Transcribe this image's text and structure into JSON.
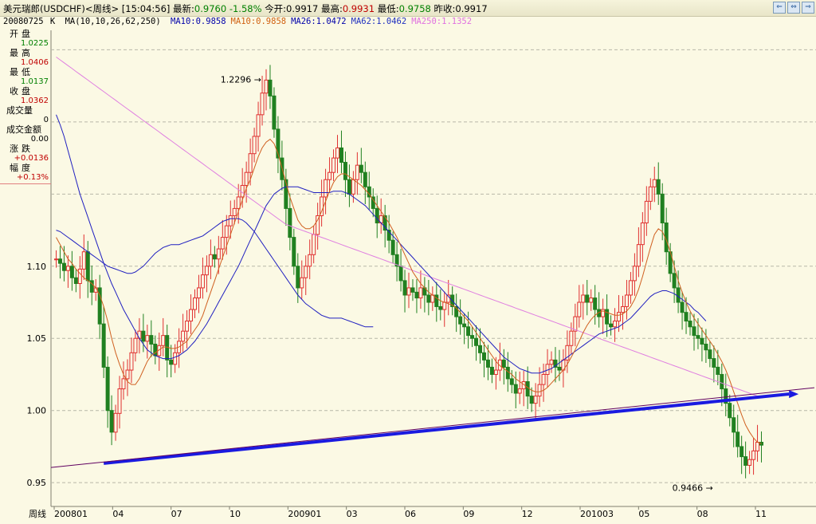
{
  "titlebar": {
    "instrument": "美元瑞郎(USDCHF)<周线>",
    "time": "[15:04:56]",
    "latest_label": "最新:",
    "latest_value": "0.9760",
    "change_pct": "-1.58%",
    "open_label": "今开:",
    "open_value": "0.9917",
    "high_label": "最高:",
    "high_value": "0.9931",
    "low_label": "最低:",
    "low_value": "0.9758",
    "prev_label": "昨收:",
    "prev_value": "0.9917"
  },
  "ma_legend": {
    "date": "20080725",
    "k": "K",
    "params": "MA(10,10,26,62,250)",
    "items": [
      {
        "label": "MA10:0.9858",
        "color": "#0000aa"
      },
      {
        "label": "MA10:0.9858",
        "color": "#d06010"
      },
      {
        "label": "MA26:1.0472",
        "color": "#0000aa"
      },
      {
        "label": "MA62:1.0462",
        "color": "#2030c0"
      },
      {
        "label": "MA250:1.1352",
        "color": "#e070e0"
      }
    ]
  },
  "side_panel": [
    {
      "label": "开盘",
      "value": "1.0225",
      "color": "#008000"
    },
    {
      "label": "最高",
      "value": "1.0406",
      "color": "#c00000"
    },
    {
      "label": "最低",
      "value": "1.0137",
      "color": "#008000"
    },
    {
      "label": "收盘",
      "value": "1.0362",
      "color": "#c00000"
    },
    {
      "label": "成交量",
      "value": "0",
      "color": "#000000"
    },
    {
      "label": "成交金额",
      "value": "0.00",
      "color": "#000000"
    },
    {
      "label": "涨跌",
      "value": "+0.0136",
      "color": "#c00000"
    },
    {
      "label": "幅度",
      "value": "+0.13%",
      "color": "#c00000"
    }
  ],
  "colors": {
    "up": "#e03030",
    "down": "#208020",
    "ma10": "#d06020",
    "ma26": "#2020c0",
    "ma250": "#e080e0",
    "trendline": "#1a1ae0",
    "grid": "#b8b8a8"
  },
  "chart_data": {
    "type": "candlestick",
    "period_label": "周线",
    "x_tick_labels": [
      "200801",
      "04",
      "07",
      "10",
      "200901",
      "03",
      "06",
      "09",
      "12",
      "201003",
      "05",
      "08",
      "11"
    ],
    "y_ticks": [
      0.95,
      1.0,
      1.05,
      1.1
    ],
    "y_tick_labels": [
      "0.95",
      "1.00",
      "1.05",
      "1.10"
    ],
    "ylim": [
      0.9335,
      1.2635
    ],
    "annotations": [
      {
        "text": "1.2296",
        "value": 1.2296,
        "week": 53
      },
      {
        "text": "0.9466",
        "value": 0.9466,
        "week": 167
      }
    ],
    "trendline": {
      "start": [
        12,
        0.9634
      ],
      "end": [
        191,
        1.0114
      ]
    },
    "close_series": [
      1.105,
      1.102,
      1.097,
      1.1,
      1.092,
      1.088,
      1.098,
      1.11,
      1.09,
      1.082,
      1.085,
      1.06,
      1.03,
      1.0,
      0.985,
      0.998,
      1.015,
      1.022,
      1.028,
      1.04,
      1.05,
      1.055,
      1.048,
      1.052,
      1.046,
      1.038,
      1.045,
      1.052,
      1.035,
      1.032,
      1.04,
      1.048,
      1.055,
      1.062,
      1.07,
      1.078,
      1.085,
      1.094,
      1.1,
      1.108,
      1.105,
      1.112,
      1.12,
      1.128,
      1.135,
      1.14,
      1.148,
      1.156,
      1.165,
      1.178,
      1.19,
      1.205,
      1.22,
      1.229,
      1.218,
      1.195,
      1.175,
      1.16,
      1.14,
      1.12,
      1.1,
      1.085,
      1.092,
      1.1,
      1.108,
      1.122,
      1.135,
      1.148,
      1.16,
      1.165,
      1.175,
      1.182,
      1.172,
      1.16,
      1.15,
      1.16,
      1.17,
      1.165,
      1.155,
      1.148,
      1.14,
      1.13,
      1.135,
      1.125,
      1.118,
      1.108,
      1.1,
      1.09,
      1.08,
      1.085,
      1.082,
      1.078,
      1.085,
      1.08,
      1.075,
      1.08,
      1.072,
      1.07,
      1.075,
      1.08,
      1.072,
      1.065,
      1.06,
      1.058,
      1.052,
      1.05,
      1.045,
      1.04,
      1.035,
      1.03,
      1.025,
      1.028,
      1.035,
      1.03,
      1.022,
      1.018,
      1.012,
      1.015,
      1.02,
      1.01,
      1.005,
      1.01,
      1.018,
      1.025,
      1.032,
      1.035,
      1.03,
      1.028,
      1.035,
      1.045,
      1.055,
      1.065,
      1.075,
      1.08,
      1.075,
      1.078,
      1.07,
      1.065,
      1.07,
      1.06,
      1.058,
      1.062,
      1.068,
      1.072,
      1.08,
      1.09,
      1.1,
      1.115,
      1.13,
      1.145,
      1.155,
      1.16,
      1.15,
      1.13,
      1.11,
      1.095,
      1.085,
      1.075,
      1.068,
      1.062,
      1.058,
      1.052,
      1.05,
      1.046,
      1.042,
      1.036,
      1.03,
      1.025,
      1.015,
      1.005,
      0.995,
      0.985,
      0.975,
      0.968,
      0.962,
      0.966,
      0.972,
      0.978,
      0.976
    ],
    "ma10": [
      1.12,
      1.115,
      1.11,
      1.105,
      1.102,
      1.098,
      1.095,
      1.092,
      1.09,
      1.088,
      1.085,
      1.08,
      1.072,
      1.062,
      1.05,
      1.04,
      1.032,
      1.025,
      1.02,
      1.018,
      1.018,
      1.022,
      1.028,
      1.034,
      1.038,
      1.04,
      1.042,
      1.044,
      1.044,
      1.043,
      1.043,
      1.044,
      1.046,
      1.048,
      1.052,
      1.056,
      1.06,
      1.066,
      1.074,
      1.082,
      1.09,
      1.098,
      1.106,
      1.114,
      1.122,
      1.13,
      1.138,
      1.146,
      1.154,
      1.16,
      1.168,
      1.176,
      1.182,
      1.186,
      1.188,
      1.185,
      1.178,
      1.168,
      1.158,
      1.148,
      1.14,
      1.132,
      1.128,
      1.126,
      1.126,
      1.128,
      1.132,
      1.138,
      1.145,
      1.152,
      1.158,
      1.162,
      1.164,
      1.164,
      1.162,
      1.16,
      1.158,
      1.156,
      1.153,
      1.15,
      1.146,
      1.142,
      1.138,
      1.134,
      1.13,
      1.125,
      1.12,
      1.114,
      1.108,
      1.102,
      1.096,
      1.092,
      1.088,
      1.085,
      1.082,
      1.08,
      1.078,
      1.076,
      1.075,
      1.074,
      1.073,
      1.071,
      1.068,
      1.065,
      1.062,
      1.058,
      1.054,
      1.05,
      1.046,
      1.042,
      1.038,
      1.034,
      1.031,
      1.029,
      1.027,
      1.025,
      1.022,
      1.02,
      1.018,
      1.016,
      1.014,
      1.013,
      1.013,
      1.014,
      1.016,
      1.019,
      1.022,
      1.025,
      1.028,
      1.032,
      1.037,
      1.042,
      1.048,
      1.054,
      1.059,
      1.063,
      1.066,
      1.068,
      1.069,
      1.068,
      1.067,
      1.066,
      1.066,
      1.067,
      1.069,
      1.072,
      1.077,
      1.084,
      1.093,
      1.103,
      1.113,
      1.122,
      1.126,
      1.124,
      1.118,
      1.11,
      1.1,
      1.09,
      1.082,
      1.075,
      1.069,
      1.064,
      1.06,
      1.056,
      1.052,
      1.048,
      1.044,
      1.039,
      1.034,
      1.028,
      1.021,
      1.013,
      1.005,
      0.997,
      0.99,
      0.985,
      0.981,
      0.978,
      0.977
    ],
    "ma26": [
      1.205,
      1.198,
      1.19,
      1.18,
      1.17,
      1.16,
      1.15,
      1.142,
      1.134,
      1.126,
      1.118,
      1.11,
      1.102,
      1.095,
      1.088,
      1.082,
      1.076,
      1.07,
      1.065,
      1.06,
      1.055,
      1.05,
      1.046,
      1.042,
      1.04,
      1.038,
      1.037,
      1.036,
      1.036,
      1.036,
      1.037,
      1.038,
      1.04,
      1.042,
      1.045,
      1.048,
      1.052,
      1.056,
      1.06,
      1.065,
      1.07,
      1.075,
      1.08,
      1.085,
      1.09,
      1.095,
      1.1,
      1.106,
      1.112,
      1.118,
      1.124,
      1.13,
      1.136,
      1.142,
      1.146,
      1.15,
      1.152,
      1.154,
      1.155,
      1.155,
      1.155,
      1.155,
      1.154,
      1.153,
      1.152,
      1.151,
      1.151,
      1.151,
      1.151,
      1.151,
      1.152,
      1.152,
      1.152,
      1.151,
      1.15,
      1.148,
      1.146,
      1.144,
      1.142,
      1.139,
      1.136,
      1.133,
      1.13,
      1.127,
      1.124,
      1.121,
      1.118,
      1.115,
      1.112,
      1.109,
      1.106,
      1.103,
      1.1,
      1.097,
      1.094,
      1.091,
      1.088,
      1.085,
      1.082,
      1.079,
      1.076,
      1.073,
      1.07,
      1.067,
      1.064,
      1.061,
      1.058,
      1.055,
      1.052,
      1.049,
      1.046,
      1.043,
      1.04,
      1.037,
      1.035,
      1.033,
      1.031,
      1.029,
      1.028,
      1.027,
      1.026,
      1.026,
      1.026,
      1.027,
      1.028,
      1.029,
      1.031,
      1.033,
      1.035,
      1.037,
      1.039,
      1.041,
      1.043,
      1.045,
      1.047,
      1.049,
      1.051,
      1.053,
      1.054,
      1.055,
      1.056,
      1.057,
      1.058,
      1.06,
      1.062,
      1.064,
      1.067,
      1.07,
      1.073,
      1.076,
      1.079,
      1.081,
      1.082,
      1.083,
      1.083,
      1.082,
      1.081,
      1.079,
      1.077,
      1.075,
      1.073,
      1.07,
      1.068,
      1.065,
      1.062
    ],
    "ma62": [
      1.125,
      1.124,
      1.122,
      1.12,
      1.118,
      1.116,
      1.114,
      1.112,
      1.11,
      1.108,
      1.106,
      1.104,
      1.102,
      1.1,
      1.099,
      1.098,
      1.097,
      1.096,
      1.095,
      1.095,
      1.096,
      1.098,
      1.1,
      1.103,
      1.106,
      1.109,
      1.111,
      1.113,
      1.114,
      1.115,
      1.115,
      1.115,
      1.116,
      1.117,
      1.118,
      1.119,
      1.12,
      1.121,
      1.123,
      1.125,
      1.127,
      1.129,
      1.131,
      1.132,
      1.133,
      1.133,
      1.133,
      1.132,
      1.13,
      1.127,
      1.124,
      1.12,
      1.116,
      1.112,
      1.108,
      1.104,
      1.1,
      1.096,
      1.092,
      1.088,
      1.084,
      1.08,
      1.077,
      1.074,
      1.072,
      1.07,
      1.068,
      1.066,
      1.065,
      1.064,
      1.064,
      1.064,
      1.064,
      1.063,
      1.062,
      1.061,
      1.06,
      1.059,
      1.058,
      1.058,
      1.058
    ],
    "ma250": [
      1.245,
      1.243,
      1.241,
      1.239,
      1.237,
      1.235,
      1.233,
      1.231,
      1.229,
      1.227,
      1.225,
      1.223,
      1.221,
      1.219,
      1.217,
      1.215,
      1.213,
      1.211,
      1.209,
      1.207,
      1.205,
      1.203,
      1.201,
      1.199,
      1.197,
      1.195,
      1.193,
      1.191,
      1.189,
      1.187,
      1.185,
      1.183,
      1.181,
      1.179,
      1.177,
      1.175,
      1.173,
      1.171,
      1.169,
      1.167,
      1.165,
      1.163,
      1.161,
      1.159,
      1.157,
      1.155,
      1.153,
      1.151,
      1.149,
      1.147,
      1.145,
      1.143,
      1.141,
      1.139,
      1.137,
      1.135,
      1.133,
      1.131,
      1.129,
      1.128,
      1.127,
      1.126,
      1.125,
      1.124,
      1.123,
      1.122,
      1.121,
      1.12,
      1.119,
      1.118,
      1.117,
      1.116,
      1.115,
      1.114,
      1.113,
      1.112,
      1.111,
      1.11,
      1.109,
      1.108,
      1.107,
      1.106,
      1.105,
      1.104,
      1.103,
      1.102,
      1.101,
      1.1,
      1.099,
      1.098,
      1.097,
      1.096,
      1.095,
      1.094,
      1.093,
      1.092,
      1.091,
      1.09,
      1.089,
      1.088,
      1.087,
      1.086,
      1.085,
      1.084,
      1.083,
      1.082,
      1.081,
      1.08,
      1.079,
      1.078,
      1.077,
      1.076,
      1.075,
      1.074,
      1.073,
      1.072,
      1.071,
      1.07,
      1.069,
      1.068,
      1.067,
      1.066,
      1.065,
      1.064,
      1.063,
      1.062,
      1.061,
      1.06,
      1.059,
      1.058,
      1.057,
      1.056,
      1.055,
      1.054,
      1.053,
      1.052,
      1.051,
      1.05,
      1.049,
      1.048,
      1.047,
      1.046,
      1.045,
      1.044,
      1.043,
      1.042,
      1.041,
      1.04,
      1.039,
      1.038,
      1.037,
      1.036,
      1.035,
      1.034,
      1.033,
      1.032,
      1.031,
      1.03,
      1.029,
      1.028,
      1.027,
      1.026,
      1.025,
      1.024,
      1.023,
      1.022,
      1.021,
      1.02,
      1.019,
      1.018,
      1.017,
      1.016,
      1.015,
      1.014,
      1.013,
      1.012,
      1.011,
      1.01
    ]
  }
}
